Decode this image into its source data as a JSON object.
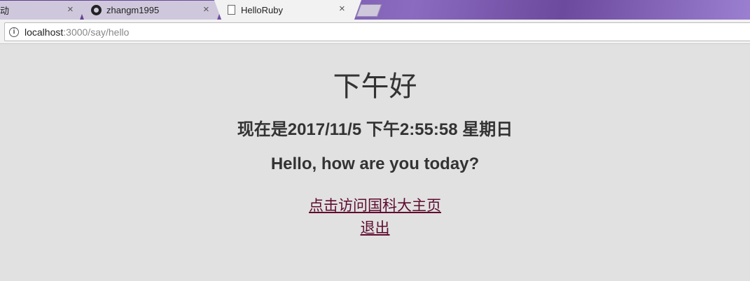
{
  "browser": {
    "tabs": [
      {
        "title": "动",
        "icon": "partial-tab-icon"
      },
      {
        "title": "zhangm1995",
        "icon": "github-icon"
      },
      {
        "title": "HelloRuby",
        "icon": "page-icon",
        "active": true
      }
    ],
    "tab_close_glyph": "×",
    "address": {
      "host": "localhost",
      "path": ":3000/say/hello"
    }
  },
  "page": {
    "greeting": "下午好",
    "datetime": "现在是2017/11/5 下午2:55:58 星期日",
    "question": "Hello, how are you today?",
    "links": [
      {
        "label": "点击访问国科大主页"
      },
      {
        "label": "退出"
      }
    ]
  },
  "colors": {
    "link": "#5e0b2e",
    "page_background": "#e1e1e1",
    "text": "#333333"
  }
}
